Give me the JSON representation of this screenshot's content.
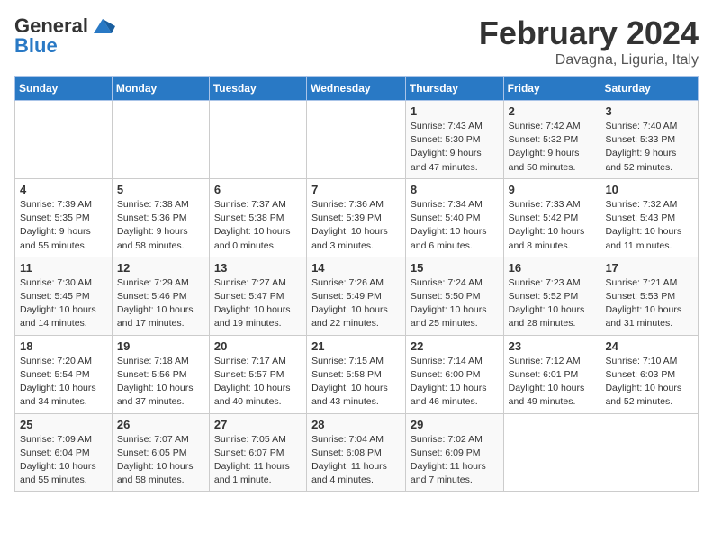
{
  "header": {
    "logo_general": "General",
    "logo_blue": "Blue",
    "title": "February 2024",
    "subtitle": "Davagna, Liguria, Italy"
  },
  "days_of_week": [
    "Sunday",
    "Monday",
    "Tuesday",
    "Wednesday",
    "Thursday",
    "Friday",
    "Saturday"
  ],
  "weeks": [
    [
      {
        "day": "",
        "info": ""
      },
      {
        "day": "",
        "info": ""
      },
      {
        "day": "",
        "info": ""
      },
      {
        "day": "",
        "info": ""
      },
      {
        "day": "1",
        "info": "Sunrise: 7:43 AM\nSunset: 5:30 PM\nDaylight: 9 hours\nand 47 minutes."
      },
      {
        "day": "2",
        "info": "Sunrise: 7:42 AM\nSunset: 5:32 PM\nDaylight: 9 hours\nand 50 minutes."
      },
      {
        "day": "3",
        "info": "Sunrise: 7:40 AM\nSunset: 5:33 PM\nDaylight: 9 hours\nand 52 minutes."
      }
    ],
    [
      {
        "day": "4",
        "info": "Sunrise: 7:39 AM\nSunset: 5:35 PM\nDaylight: 9 hours\nand 55 minutes."
      },
      {
        "day": "5",
        "info": "Sunrise: 7:38 AM\nSunset: 5:36 PM\nDaylight: 9 hours\nand 58 minutes."
      },
      {
        "day": "6",
        "info": "Sunrise: 7:37 AM\nSunset: 5:38 PM\nDaylight: 10 hours\nand 0 minutes."
      },
      {
        "day": "7",
        "info": "Sunrise: 7:36 AM\nSunset: 5:39 PM\nDaylight: 10 hours\nand 3 minutes."
      },
      {
        "day": "8",
        "info": "Sunrise: 7:34 AM\nSunset: 5:40 PM\nDaylight: 10 hours\nand 6 minutes."
      },
      {
        "day": "9",
        "info": "Sunrise: 7:33 AM\nSunset: 5:42 PM\nDaylight: 10 hours\nand 8 minutes."
      },
      {
        "day": "10",
        "info": "Sunrise: 7:32 AM\nSunset: 5:43 PM\nDaylight: 10 hours\nand 11 minutes."
      }
    ],
    [
      {
        "day": "11",
        "info": "Sunrise: 7:30 AM\nSunset: 5:45 PM\nDaylight: 10 hours\nand 14 minutes."
      },
      {
        "day": "12",
        "info": "Sunrise: 7:29 AM\nSunset: 5:46 PM\nDaylight: 10 hours\nand 17 minutes."
      },
      {
        "day": "13",
        "info": "Sunrise: 7:27 AM\nSunset: 5:47 PM\nDaylight: 10 hours\nand 19 minutes."
      },
      {
        "day": "14",
        "info": "Sunrise: 7:26 AM\nSunset: 5:49 PM\nDaylight: 10 hours\nand 22 minutes."
      },
      {
        "day": "15",
        "info": "Sunrise: 7:24 AM\nSunset: 5:50 PM\nDaylight: 10 hours\nand 25 minutes."
      },
      {
        "day": "16",
        "info": "Sunrise: 7:23 AM\nSunset: 5:52 PM\nDaylight: 10 hours\nand 28 minutes."
      },
      {
        "day": "17",
        "info": "Sunrise: 7:21 AM\nSunset: 5:53 PM\nDaylight: 10 hours\nand 31 minutes."
      }
    ],
    [
      {
        "day": "18",
        "info": "Sunrise: 7:20 AM\nSunset: 5:54 PM\nDaylight: 10 hours\nand 34 minutes."
      },
      {
        "day": "19",
        "info": "Sunrise: 7:18 AM\nSunset: 5:56 PM\nDaylight: 10 hours\nand 37 minutes."
      },
      {
        "day": "20",
        "info": "Sunrise: 7:17 AM\nSunset: 5:57 PM\nDaylight: 10 hours\nand 40 minutes."
      },
      {
        "day": "21",
        "info": "Sunrise: 7:15 AM\nSunset: 5:58 PM\nDaylight: 10 hours\nand 43 minutes."
      },
      {
        "day": "22",
        "info": "Sunrise: 7:14 AM\nSunset: 6:00 PM\nDaylight: 10 hours\nand 46 minutes."
      },
      {
        "day": "23",
        "info": "Sunrise: 7:12 AM\nSunset: 6:01 PM\nDaylight: 10 hours\nand 49 minutes."
      },
      {
        "day": "24",
        "info": "Sunrise: 7:10 AM\nSunset: 6:03 PM\nDaylight: 10 hours\nand 52 minutes."
      }
    ],
    [
      {
        "day": "25",
        "info": "Sunrise: 7:09 AM\nSunset: 6:04 PM\nDaylight: 10 hours\nand 55 minutes."
      },
      {
        "day": "26",
        "info": "Sunrise: 7:07 AM\nSunset: 6:05 PM\nDaylight: 10 hours\nand 58 minutes."
      },
      {
        "day": "27",
        "info": "Sunrise: 7:05 AM\nSunset: 6:07 PM\nDaylight: 11 hours\nand 1 minute."
      },
      {
        "day": "28",
        "info": "Sunrise: 7:04 AM\nSunset: 6:08 PM\nDaylight: 11 hours\nand 4 minutes."
      },
      {
        "day": "29",
        "info": "Sunrise: 7:02 AM\nSunset: 6:09 PM\nDaylight: 11 hours\nand 7 minutes."
      },
      {
        "day": "",
        "info": ""
      },
      {
        "day": "",
        "info": ""
      }
    ]
  ]
}
